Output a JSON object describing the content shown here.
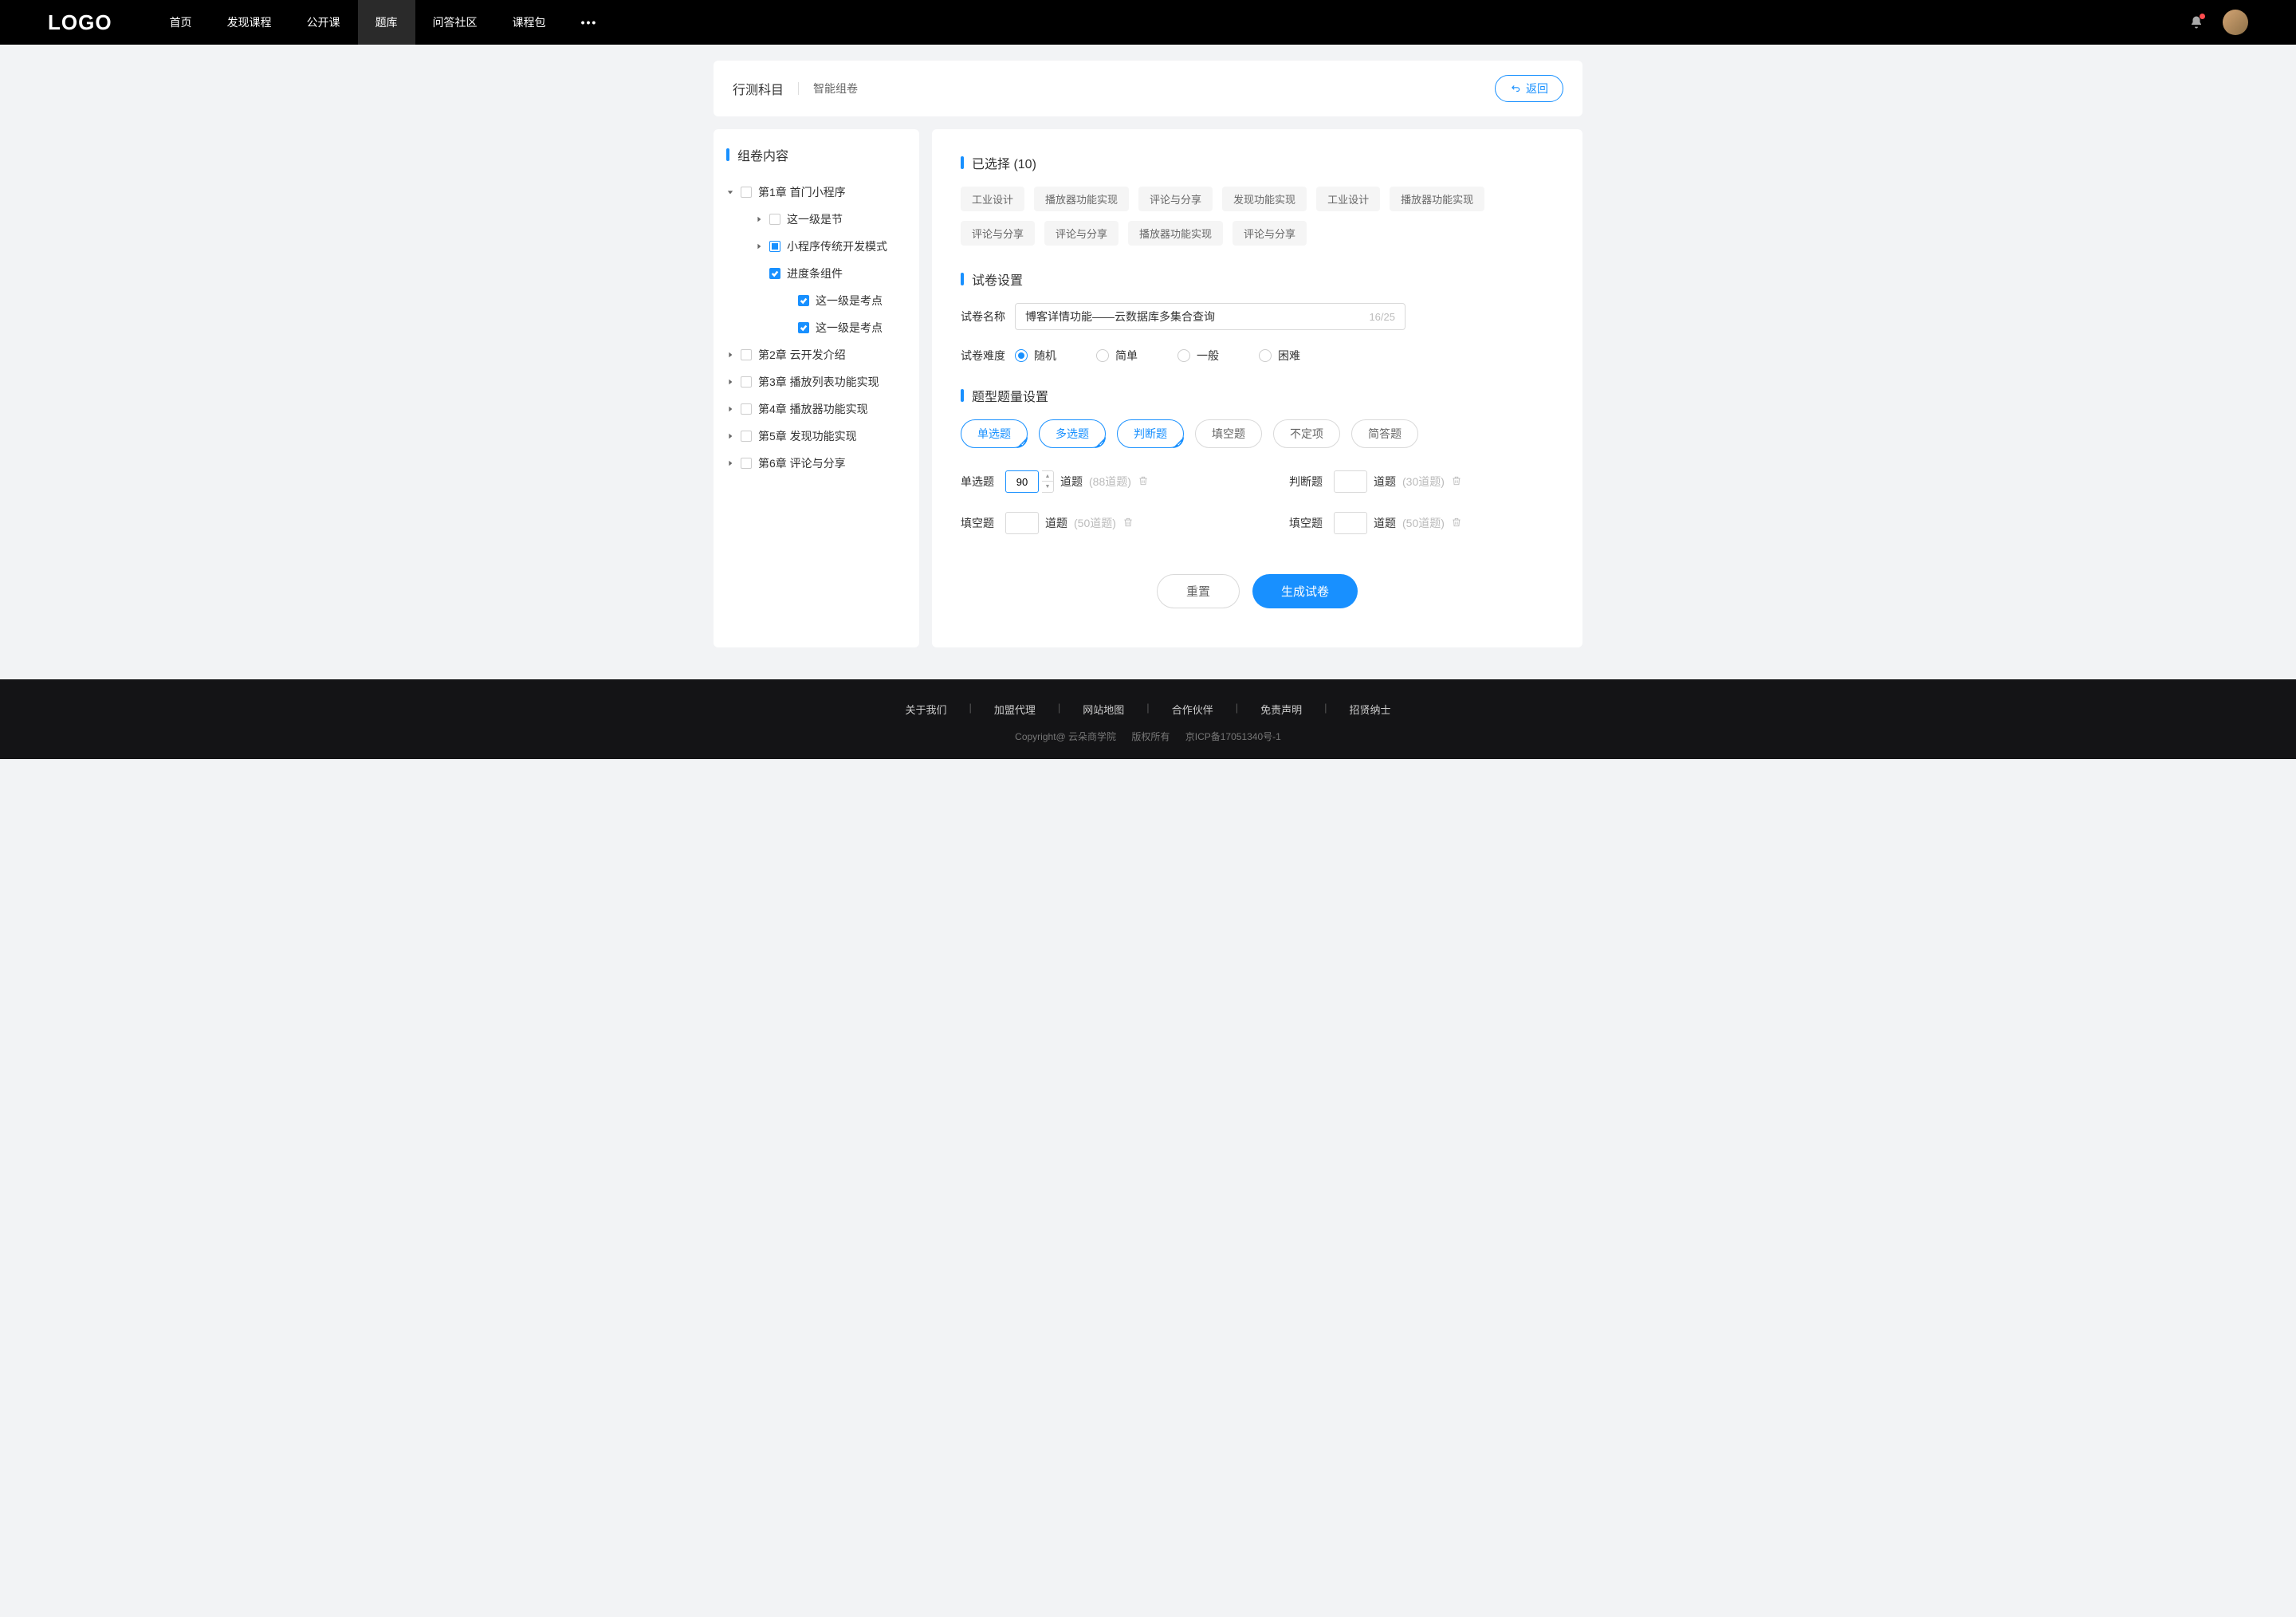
{
  "nav": {
    "logo": "LOGO",
    "items": [
      "首页",
      "发现课程",
      "公开课",
      "题库",
      "问答社区",
      "课程包"
    ],
    "active_index": 3,
    "more": "•••"
  },
  "header": {
    "title": "行测科目",
    "sub": "智能组卷",
    "back": "返回"
  },
  "sidebar": {
    "title": "组卷内容",
    "tree": [
      {
        "label": "第1章 首门小程序",
        "level": 0,
        "caret": "down",
        "check": "empty",
        "children": [
          {
            "label": "这一级是节",
            "level": 1,
            "caret": "right",
            "check": "empty"
          },
          {
            "label": "小程序传统开发模式",
            "level": 1,
            "caret": "right",
            "check": "partial"
          },
          {
            "label": "进度条组件",
            "level": 1,
            "caret": "none",
            "check": "checked",
            "children": [
              {
                "label": "这一级是考点",
                "level": 2,
                "caret": "none",
                "check": "checked"
              },
              {
                "label": "这一级是考点",
                "level": 2,
                "caret": "none",
                "check": "checked"
              }
            ]
          }
        ]
      },
      {
        "label": "第2章 云开发介绍",
        "level": 0,
        "caret": "right",
        "check": "empty"
      },
      {
        "label": "第3章 播放列表功能实现",
        "level": 0,
        "caret": "right",
        "check": "empty"
      },
      {
        "label": "第4章 播放器功能实现",
        "level": 0,
        "caret": "right",
        "check": "empty"
      },
      {
        "label": "第5章 发现功能实现",
        "level": 0,
        "caret": "right",
        "check": "empty"
      },
      {
        "label": "第6章 评论与分享",
        "level": 0,
        "caret": "right",
        "check": "empty"
      }
    ]
  },
  "selected": {
    "title": "已选择 (10)",
    "chips": [
      "工业设计",
      "播放器功能实现",
      "评论与分享",
      "发现功能实现",
      "工业设计",
      "播放器功能实现",
      "评论与分享",
      "评论与分享",
      "播放器功能实现",
      "评论与分享"
    ]
  },
  "settings": {
    "title": "试卷设置",
    "name_label": "试卷名称",
    "name_value": "博客详情功能——云数据库多集合查询",
    "name_count": "16/25",
    "difficulty_label": "试卷难度",
    "difficulties": [
      {
        "label": "随机",
        "selected": true
      },
      {
        "label": "简单",
        "selected": false
      },
      {
        "label": "一般",
        "selected": false
      },
      {
        "label": "困难",
        "selected": false
      }
    ]
  },
  "types": {
    "title": "题型题量设置",
    "pills": [
      {
        "label": "单选题",
        "selected": true
      },
      {
        "label": "多选题",
        "selected": true
      },
      {
        "label": "判断题",
        "selected": true
      },
      {
        "label": "填空题",
        "selected": false
      },
      {
        "label": "不定项",
        "selected": false
      },
      {
        "label": "简答题",
        "selected": false
      }
    ],
    "rows": [
      {
        "label": "单选题",
        "value": "90",
        "unit": "道题",
        "hint": "(88道题)",
        "active": true
      },
      {
        "label": "判断题",
        "value": "",
        "unit": "道题",
        "hint": "(30道题)",
        "active": false
      },
      {
        "label": "填空题",
        "value": "",
        "unit": "道题",
        "hint": "(50道题)",
        "active": false
      },
      {
        "label": "填空题",
        "value": "",
        "unit": "道题",
        "hint": "(50道题)",
        "active": false
      }
    ]
  },
  "actions": {
    "reset": "重置",
    "submit": "生成试卷"
  },
  "footer": {
    "links": [
      "关于我们",
      "加盟代理",
      "网站地图",
      "合作伙伴",
      "免责声明",
      "招贤纳士"
    ],
    "copy1": "Copyright@ 云朵商学院",
    "copy2": "版权所有",
    "copy3": "京ICP备17051340号-1"
  }
}
